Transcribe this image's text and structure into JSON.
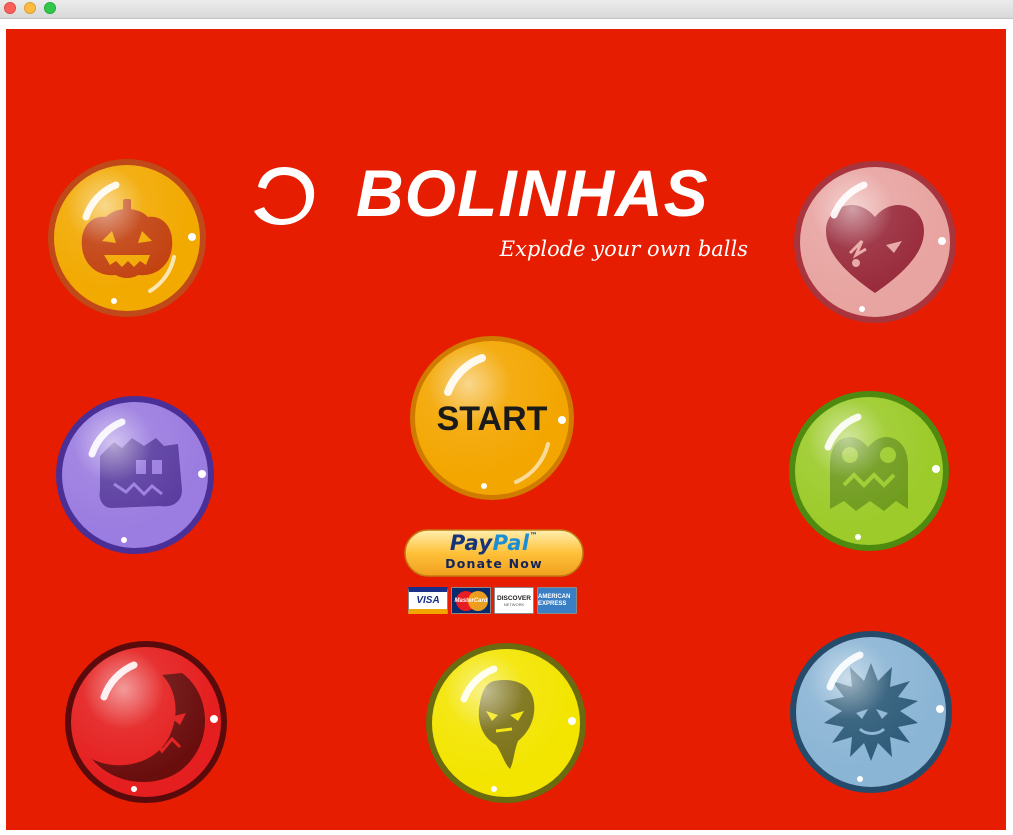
{
  "window": {
    "title": ""
  },
  "app": {
    "title": "BOLINHAS",
    "tagline": "Explode your own balls"
  },
  "start_button": {
    "label": "START",
    "color": "#f3a600"
  },
  "donate": {
    "brand_pay": "Pay",
    "brand_pal": "Pal",
    "trademark": "™",
    "label": "Donate Now",
    "cards": [
      "VISA",
      "MasterCard",
      "DISCOVER",
      "AMERICAN EXPRESS"
    ],
    "discover_sub": "NETWORK"
  },
  "balls": [
    {
      "id": "pumpkin",
      "color": "#f0a800",
      "rim": "#c24f10",
      "face": "#c2410f",
      "icon": "pumpkin-icon"
    },
    {
      "id": "heart",
      "color": "#e7a3a0",
      "rim": "#a8343e",
      "face": "#9b2a36",
      "icon": "broken-heart-icon"
    },
    {
      "id": "purple-monster",
      "color": "#9b7be0",
      "rim": "#4a2f96",
      "face": "#5a3ca0",
      "icon": "purple-monster-icon"
    },
    {
      "id": "green-monster",
      "color": "#9ccb2a",
      "rim": "#4f8a10",
      "face": "#6d9a1a",
      "icon": "green-monster-icon"
    },
    {
      "id": "red-moon",
      "color": "#e61e1e",
      "rim": "#5a0a0a",
      "face": "#6a0d0d",
      "icon": "moon-face-icon"
    },
    {
      "id": "yellow-ghost",
      "color": "#f2e400",
      "rim": "#7a7a10",
      "face": "#7a7010",
      "icon": "ghost-icon"
    },
    {
      "id": "blue-spiky",
      "color": "#8ab4d4",
      "rim": "#264a6a",
      "face": "#2c5a78",
      "icon": "spiky-ball-icon"
    }
  ]
}
